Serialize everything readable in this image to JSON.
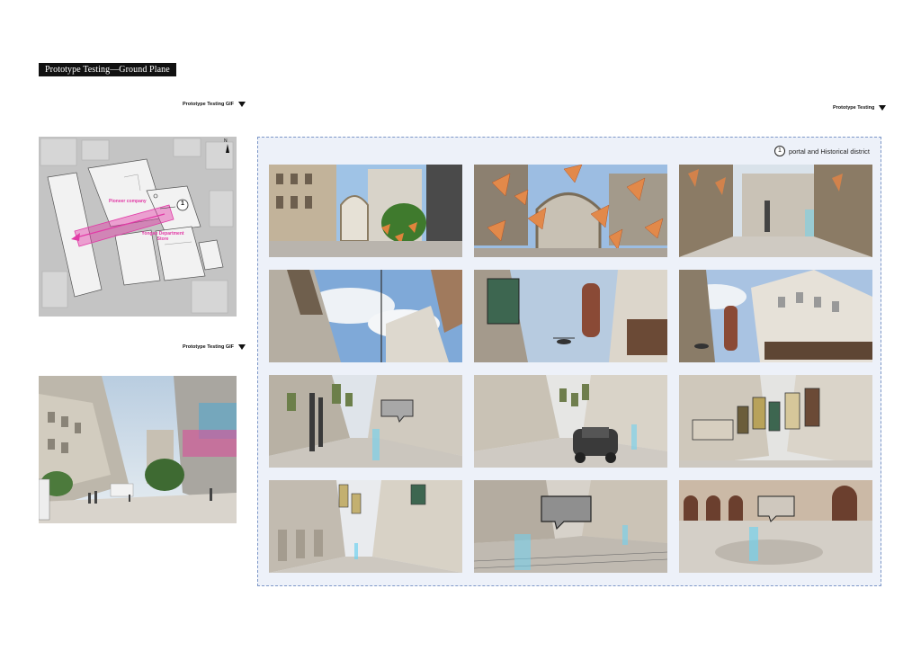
{
  "title": "Prototype Testing—Ground Plane",
  "gif_labels": {
    "top_left": "Prototype Testing GIF",
    "top_right": "Prototype Testing",
    "middle_left": "Prototype Testing GIF"
  },
  "map": {
    "marker_number": "1",
    "label_pioneer": "Pioneer company",
    "label_store": "Yongan Department Store",
    "accent_color": "#e23aa6",
    "north_symbol": "N"
  },
  "panel": {
    "legend_number": "1",
    "legend_text": "portal and Historical district"
  },
  "frames": [
    {
      "row": 1,
      "col": 1,
      "scene": "gate-plaza"
    },
    {
      "row": 1,
      "col": 2,
      "scene": "orange-petals-gate"
    },
    {
      "row": 1,
      "col": 3,
      "scene": "gate-doors"
    },
    {
      "row": 2,
      "col": 1,
      "scene": "look-up-sky"
    },
    {
      "row": 2,
      "col": 2,
      "scene": "signs-helicopter"
    },
    {
      "row": 2,
      "col": 3,
      "scene": "sincere-building"
    },
    {
      "row": 3,
      "col": 1,
      "scene": "street-avatar"
    },
    {
      "row": 3,
      "col": 2,
      "scene": "vintage-car"
    },
    {
      "row": 3,
      "col": 3,
      "scene": "signboards"
    },
    {
      "row": 4,
      "col": 1,
      "scene": "arcade-street"
    },
    {
      "row": 4,
      "col": 2,
      "scene": "speech-bubble-street"
    },
    {
      "row": 4,
      "col": 3,
      "scene": "arches-plaza"
    }
  ]
}
